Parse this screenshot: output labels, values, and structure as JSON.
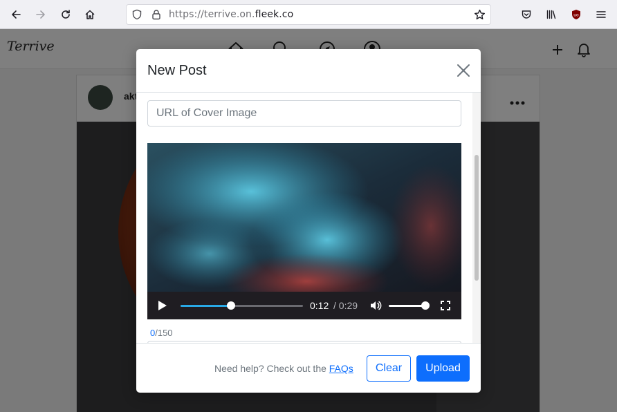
{
  "browser": {
    "url_prefix": "https://terrive.on.",
    "url_host": "fleek.co",
    "icons": [
      "back-arrow-icon",
      "forward-arrow-icon",
      "reload-icon",
      "home-icon",
      "shield-icon",
      "lock-icon",
      "bookmark-star-icon",
      "pocket-icon",
      "library-icon",
      "ublock-icon",
      "hamburger-menu-icon"
    ]
  },
  "app": {
    "brand": "Terrive",
    "nav_icons": [
      "home-icon",
      "search-icon",
      "explore-icon",
      "profile-icon"
    ],
    "header_actions": [
      "plus-icon",
      "bell-icon"
    ],
    "post": {
      "username_partial": "akt",
      "more_icon": "more-dots-icon"
    }
  },
  "modal": {
    "title": "New Post",
    "cover_placeholder": "URL of Cover Image",
    "video": {
      "current_time": "0:12",
      "separator_duration": "/ 0:29",
      "progress_fraction": 0.41,
      "volume_fraction": 0.98
    },
    "char_count_current": "0",
    "char_count_max": "/150",
    "help_prefix": "Need help? Check out the ",
    "help_link": "FAQs",
    "clear_label": "Clear",
    "upload_label": "Upload"
  },
  "colors": {
    "primary": "#0d6efd",
    "seek_fill": "#29a9e6",
    "overlay": "rgba(0,0,0,0.5)"
  }
}
